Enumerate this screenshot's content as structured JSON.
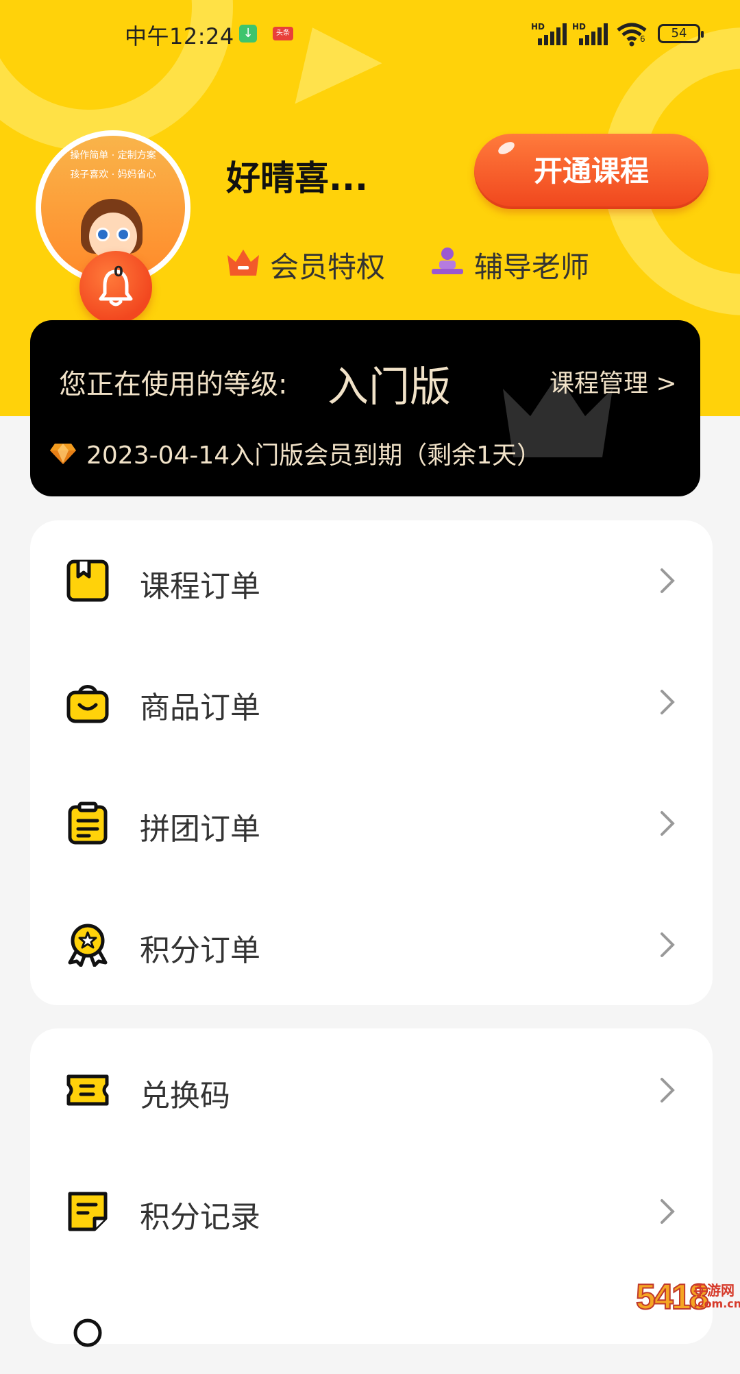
{
  "status_bar": {
    "time": "中午12:24",
    "download_badge": "↓",
    "news_badge": "头条",
    "signal_label_1": "HD",
    "signal_label_2": "HD",
    "wifi_sub": "6",
    "battery": "54"
  },
  "profile": {
    "avatar_text_line1": "操作简单 · 定制方案",
    "avatar_text_line2": "孩子喜欢 · 妈妈省心",
    "username": "好晴喜...",
    "notification_count": "0",
    "open_course_button": "开通课程",
    "perks": [
      {
        "label": "会员特权",
        "icon": "crown-icon"
      },
      {
        "label": "辅导老师",
        "icon": "teacher-icon"
      }
    ]
  },
  "level_card": {
    "prefix": "您正在使用的等级:",
    "level": "入门版",
    "manage_link": "课程管理 >",
    "expiry": "2023-04-14入门版会员到期（剩余1天）"
  },
  "menu_group_1": [
    {
      "label": "课程订单",
      "icon": "course-book-icon"
    },
    {
      "label": "商品订单",
      "icon": "shopping-bag-icon"
    },
    {
      "label": "拼团订单",
      "icon": "clipboard-icon"
    },
    {
      "label": "积分订单",
      "icon": "medal-icon"
    }
  ],
  "menu_group_2": [
    {
      "label": "兑换码",
      "icon": "ticket-icon"
    },
    {
      "label": "积分记录",
      "icon": "note-icon"
    }
  ],
  "watermark": {
    "number": "5418",
    "text": "手游网",
    "domain": ".com.cn"
  },
  "colors": {
    "header_yellow": "#ffd20a",
    "accent_orange": "#f0461d",
    "level_card_bg": "#000000",
    "level_text_gold": "#f1e2c8"
  }
}
